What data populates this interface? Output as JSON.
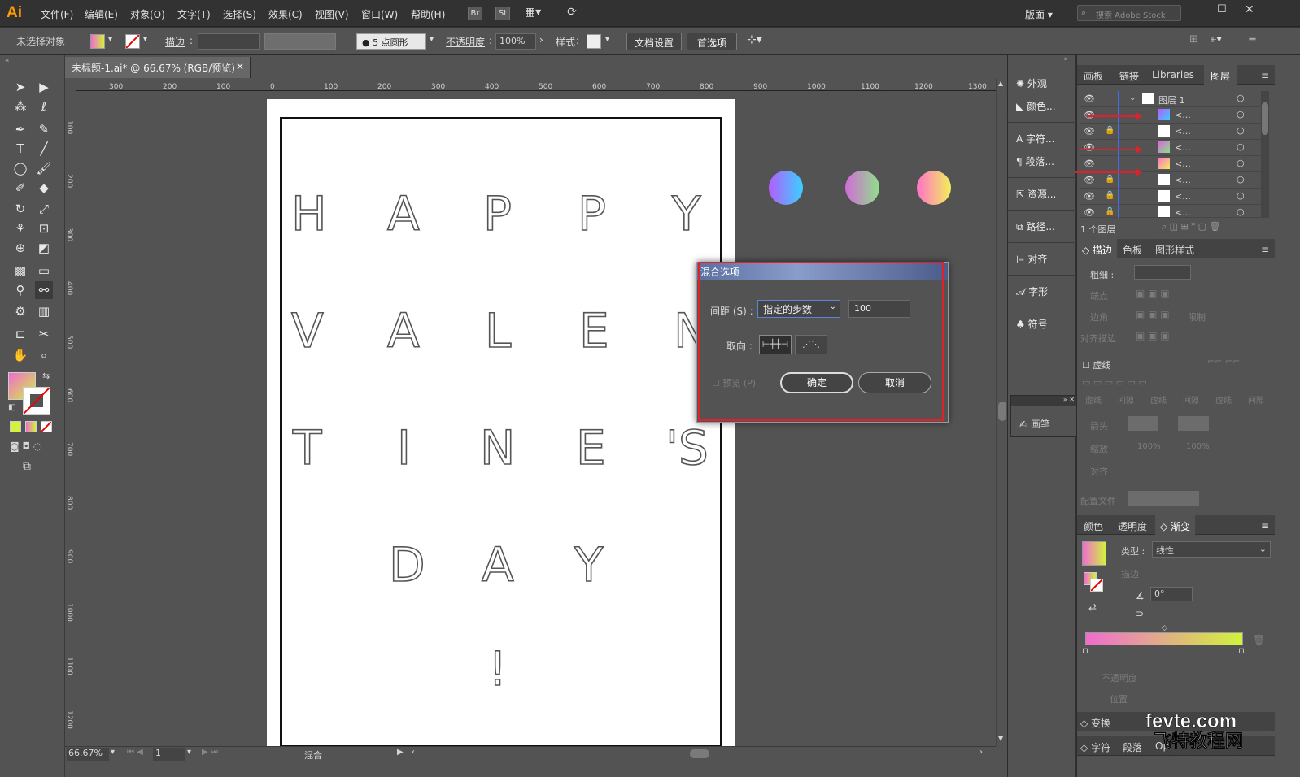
{
  "app": {
    "logo": "Ai"
  },
  "menu": [
    "文件(F)",
    "编辑(E)",
    "对象(O)",
    "文字(T)",
    "选择(S)",
    "效果(C)",
    "视图(V)",
    "窗口(W)",
    "帮助(H)"
  ],
  "menu_icons": {
    "br": "Br",
    "st": "St"
  },
  "workspace": "版面",
  "search_placeholder": "搜索 Adobe Stock",
  "control": {
    "selection": "未选择对象",
    "stroke_label": "描边",
    "brush": "5 点圆形",
    "opacity_label": "不透明度",
    "opacity_value": "100%",
    "style_label": "样式",
    "doc_setup": "文档设置",
    "prefs": "首选项"
  },
  "doc_tab": "未标题-1.ai* @ 66.67% (RGB/预览)",
  "ruler_h": [
    "300",
    "200",
    "100",
    "0",
    "100",
    "200",
    "300",
    "400",
    "500",
    "600",
    "700",
    "800",
    "900",
    "1000",
    "1100",
    "1200",
    "1300"
  ],
  "ruler_v": [
    "100",
    "200",
    "300",
    "400",
    "500",
    "600",
    "700",
    "800",
    "900",
    "1000",
    "1100",
    "1200"
  ],
  "artwork": {
    "rows": [
      [
        "H",
        "A",
        "P",
        "P",
        "Y"
      ],
      [
        "V",
        "A",
        "L",
        "E",
        "N"
      ],
      [
        "T",
        "I",
        "N",
        "E",
        "'S"
      ],
      [
        "D",
        "A",
        "Y"
      ],
      [
        "!"
      ]
    ],
    "circles": [
      {
        "from": "#b45cff",
        "to": "#3ad0ff"
      },
      {
        "from": "#d36bd8",
        "to": "#8fe08a"
      },
      {
        "from": "#ff72c8",
        "to": "#f2f05a"
      }
    ]
  },
  "status": {
    "zoom": "66.67%",
    "page": "1",
    "mode": "混合"
  },
  "right_col1": [
    "外观",
    "颜色...",
    "字符...",
    "段落...",
    "资源...",
    "路径...",
    "对齐",
    "字形",
    "符号"
  ],
  "brush_panel": "画笔",
  "layers_tabs": [
    "画板",
    "链接",
    "Libraries",
    "图层"
  ],
  "layers": {
    "top": "图层 1",
    "rows": [
      "<...",
      "<...",
      "<...",
      "<...",
      "<...",
      "<...",
      "<..."
    ],
    "count": "1 个图层"
  },
  "stroke_tabs": [
    "描边",
    "色板",
    "图形样式"
  ],
  "stroke": {
    "weight": "粗细",
    "cap": "端点",
    "corner": "边角",
    "limit": "限制",
    "align": "对齐描边",
    "dashed": "虚线",
    "dash_labels": [
      "虚线",
      "间隙",
      "虚线",
      "间隙",
      "虚线",
      "间隙"
    ],
    "arrowhead": "箭头",
    "scale": "缩放",
    "scale_v1": "100%",
    "scale_v2": "100%",
    "align2": "对齐",
    "profile": "配置文件"
  },
  "grad_tabs": [
    "颜色",
    "透明度",
    "渐变"
  ],
  "gradient": {
    "type_label": "类型",
    "type_value": "线性",
    "stroke_label": "描边",
    "angle": "0°",
    "opacity": "不透明度",
    "location": "位置",
    "from": "#f06ccf",
    "to": "#d2f23c"
  },
  "bottom_tabs": [
    "变换",
    "字符",
    "段落",
    "Op"
  ],
  "dialog": {
    "title": "混合选项",
    "spacing_label": "间距 (S)",
    "spacing_mode": "指定的步数",
    "steps": "100",
    "orient_label": "取向",
    "preview": "预览 (P)",
    "ok": "确定",
    "cancel": "取消"
  },
  "watermark": {
    "line1": "fevte.com",
    "line2": "飞特教程网"
  }
}
